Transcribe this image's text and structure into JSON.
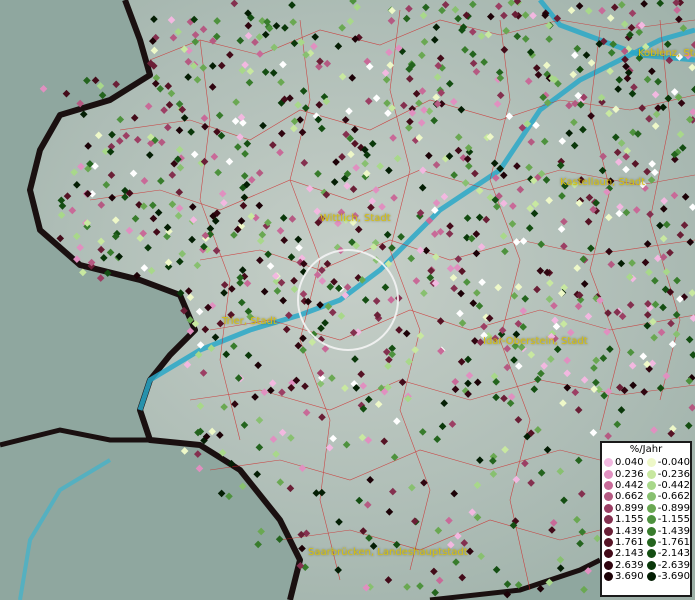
{
  "map": {
    "places": [
      {
        "name": "Koblenz, Stadt"
      },
      {
        "name": "Kastellaun, Stadt"
      },
      {
        "name": "Wittlich, Stadt"
      },
      {
        "name": "Trier, Stadt"
      },
      {
        "name": "Idar-Oberstein, Stadt"
      },
      {
        "name": "Saarbrücken, Landeshauptstadt"
      }
    ]
  },
  "legend": {
    "title": "%/Jahr",
    "positive": [
      {
        "label": "0.040",
        "color": "#f2b8e0"
      },
      {
        "label": "0.236",
        "color": "#e090c0"
      },
      {
        "label": "0.442",
        "color": "#c86a98"
      },
      {
        "label": "0.662",
        "color": "#b55a82"
      },
      {
        "label": "0.899",
        "color": "#9c3f64"
      },
      {
        "label": "1.155",
        "color": "#84304f"
      },
      {
        "label": "1.439",
        "color": "#6a1f36"
      },
      {
        "label": "1.761",
        "color": "#561325"
      },
      {
        "label": "2.143",
        "color": "#430b19"
      },
      {
        "label": "2.639",
        "color": "#300510"
      },
      {
        "label": "3.690",
        "color": "#1c0207"
      }
    ],
    "negative": [
      {
        "label": "-0.040",
        "color": "#eef8c8"
      },
      {
        "label": "-0.236",
        "color": "#c8e8a0"
      },
      {
        "label": "-0.442",
        "color": "#a8d88a"
      },
      {
        "label": "-0.662",
        "color": "#88c070"
      },
      {
        "label": "-0.899",
        "color": "#6aa852"
      },
      {
        "label": "-1.155",
        "color": "#4e923e"
      },
      {
        "label": "-1.439",
        "color": "#387c2c"
      },
      {
        "label": "-1.761",
        "color": "#24641e"
      },
      {
        "label": "-2.143",
        "color": "#144e12"
      },
      {
        "label": "-2.639",
        "color": "#0a380a"
      },
      {
        "label": "-3.690",
        "color": "#041e04"
      }
    ]
  },
  "colors": {
    "land": "#a9bab4",
    "outside": "#8fa9a0",
    "border": "#1a1010",
    "water": "#2aa8c8",
    "district_lines": "#d02020",
    "place_label": "#d8c010"
  },
  "icons": {
    "focus_ring": "circle-highlight-icon",
    "measuring_point": "diamond-marker-icon"
  }
}
